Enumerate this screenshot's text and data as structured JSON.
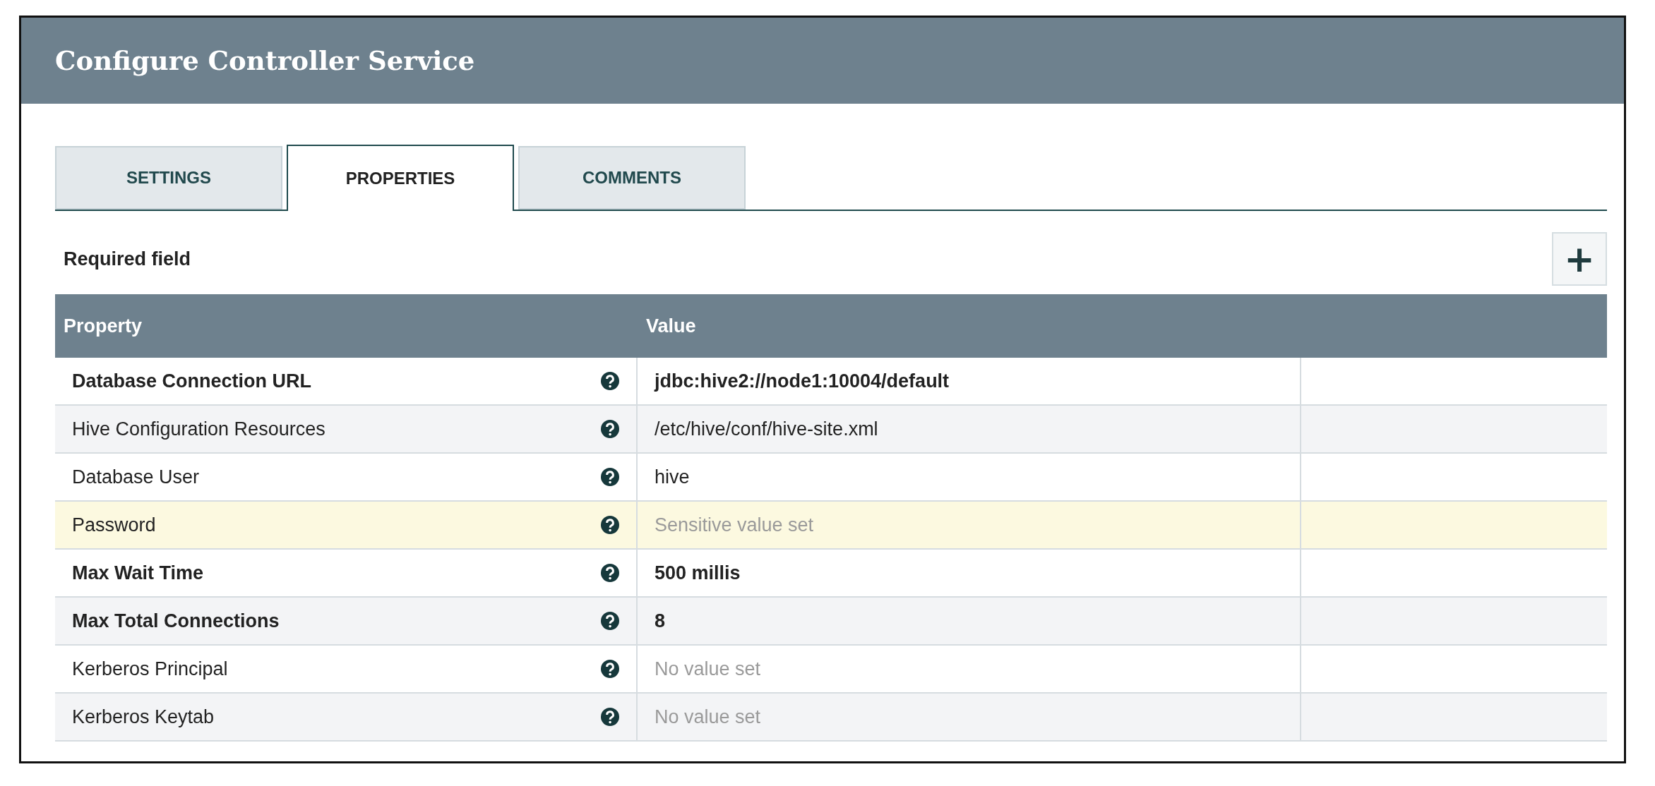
{
  "dialog": {
    "title": "Configure Controller Service"
  },
  "tabs": [
    {
      "label": "SETTINGS",
      "selected": false
    },
    {
      "label": "PROPERTIES",
      "selected": true
    },
    {
      "label": "COMMENTS",
      "selected": false
    }
  ],
  "required_note": "Required field",
  "add_button": {
    "label": "+"
  },
  "table": {
    "columns": [
      "Property",
      "Value"
    ],
    "rows": [
      {
        "name": "Database Connection URL",
        "required": true,
        "value": "jdbc:hive2://node1:10004/default",
        "muted": false,
        "selected": false
      },
      {
        "name": "Hive Configuration Resources",
        "required": false,
        "value": "/etc/hive/conf/hive-site.xml",
        "muted": false,
        "selected": false
      },
      {
        "name": "Database User",
        "required": false,
        "value": "hive",
        "muted": false,
        "selected": false
      },
      {
        "name": "Password",
        "required": false,
        "value": "Sensitive value set",
        "muted": true,
        "selected": true
      },
      {
        "name": "Max Wait Time",
        "required": true,
        "value": "500 millis",
        "muted": false,
        "selected": false
      },
      {
        "name": "Max Total Connections",
        "required": true,
        "value": "8",
        "muted": false,
        "selected": false
      },
      {
        "name": "Kerberos Principal",
        "required": false,
        "value": "No value set",
        "muted": true,
        "selected": false
      },
      {
        "name": "Kerberos Keytab",
        "required": false,
        "value": "No value set",
        "muted": true,
        "selected": false
      }
    ]
  }
}
